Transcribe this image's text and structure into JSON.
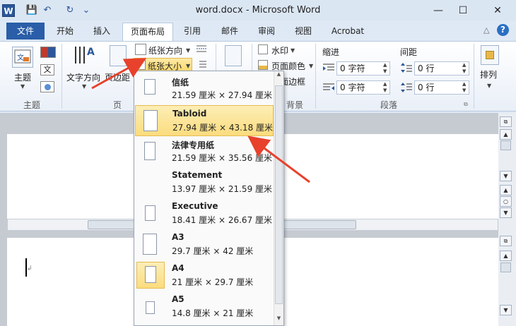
{
  "window": {
    "title": "word.docx - Microsoft Word",
    "app_icon": "W"
  },
  "qat": {
    "save_icon": "💾",
    "undo_icon": "↶",
    "redo_icon": "↻",
    "customize_icon": "⌄"
  },
  "window_controls": {
    "minimize": "—",
    "maximize": "☐",
    "close": "✕"
  },
  "tabs": {
    "file": "文件",
    "items": [
      "开始",
      "插入",
      "页面布局",
      "引用",
      "邮件",
      "审阅",
      "视图",
      "Acrobat"
    ],
    "active_index": 2
  },
  "help": {
    "collapse": "△",
    "help": "?"
  },
  "ribbon": {
    "themes": {
      "label": "主题",
      "group": "主题"
    },
    "page_setup": {
      "text_direction": "文字方向",
      "margins": "页边距",
      "orientation": "纸张方向",
      "size": "纸张大小",
      "group": "页"
    },
    "background": {
      "watermark": "水印",
      "page_color": "页面颜色",
      "page_borders": "页面边框",
      "group": "背景"
    },
    "paragraph": {
      "indent": "缩进",
      "spacing": "间距",
      "indent_left": "0 字符",
      "indent_right": "0 字符",
      "space_before": "0 行",
      "space_after": "0 行",
      "group": "段落"
    },
    "arrange": {
      "label": "排列"
    }
  },
  "paper_menu": {
    "selected": "Tabloid",
    "items": [
      {
        "name": "信纸",
        "dims": "21.59 厘米 × 27.94 厘米"
      },
      {
        "name": "Tabloid",
        "dims": "27.94 厘米 × 43.18 厘米"
      },
      {
        "name": "法律专用纸",
        "dims": "21.59 厘米 × 35.56 厘米"
      },
      {
        "name": "Statement",
        "dims": "13.97 厘米 × 21.59 厘米"
      },
      {
        "name": "Executive",
        "dims": "18.41 厘米 × 26.67 厘米"
      },
      {
        "name": "A3",
        "dims": "29.7 厘米 × 42 厘米"
      },
      {
        "name": "A4",
        "dims": "21 厘米 × 29.7 厘米"
      },
      {
        "name": "A5",
        "dims": "14.8 厘米 × 21 厘米"
      }
    ]
  },
  "colors": {
    "accent": "#2b579a",
    "highlight": "#fbdc7e",
    "arrow": "#e8412c"
  }
}
